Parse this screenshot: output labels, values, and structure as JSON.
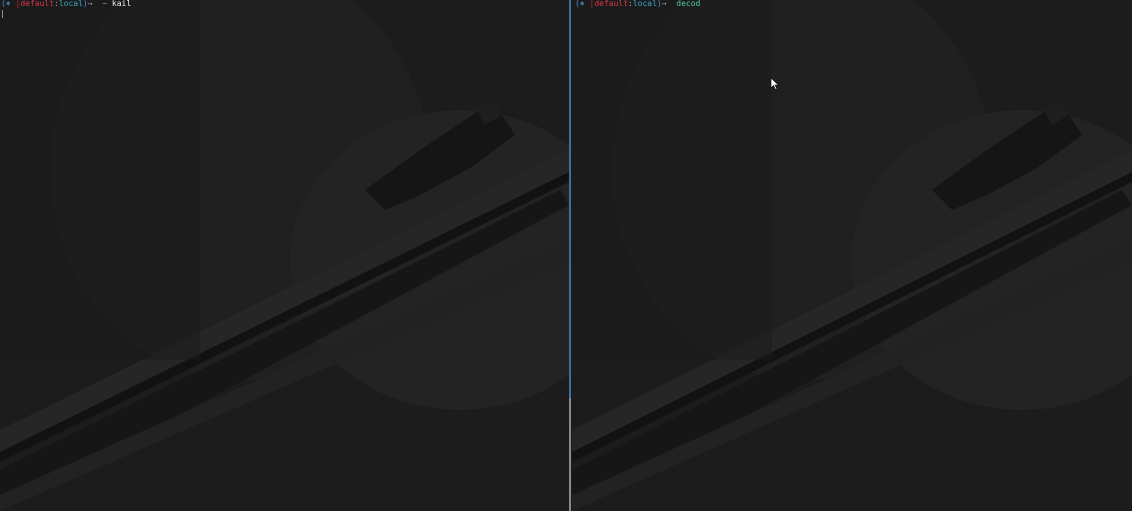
{
  "left_pane": {
    "prompt": {
      "open_paren": "(",
      "icon": "⎈",
      "separator": "|",
      "context": "default",
      "colon": ":",
      "namespace": "local",
      "close_paren": ")",
      "arrow": "→",
      "tilde": "~",
      "command": "kail"
    }
  },
  "right_pane": {
    "prompt": {
      "open_paren": "(",
      "icon": "⎈",
      "separator": "|",
      "context": "default",
      "colon": ":",
      "namespace": "local",
      "close_paren": ")",
      "arrow": "→",
      "command": "decod"
    }
  },
  "colors": {
    "background": "#1b1b1b",
    "divider_active": "#3f6f9a",
    "context": "#d9374a",
    "namespace": "#39a7c9",
    "command_typed": "#4fd0a0"
  },
  "icons": {
    "kube_context_icon": "helm-wheel-icon",
    "pointer": "mouse-pointer-icon"
  }
}
